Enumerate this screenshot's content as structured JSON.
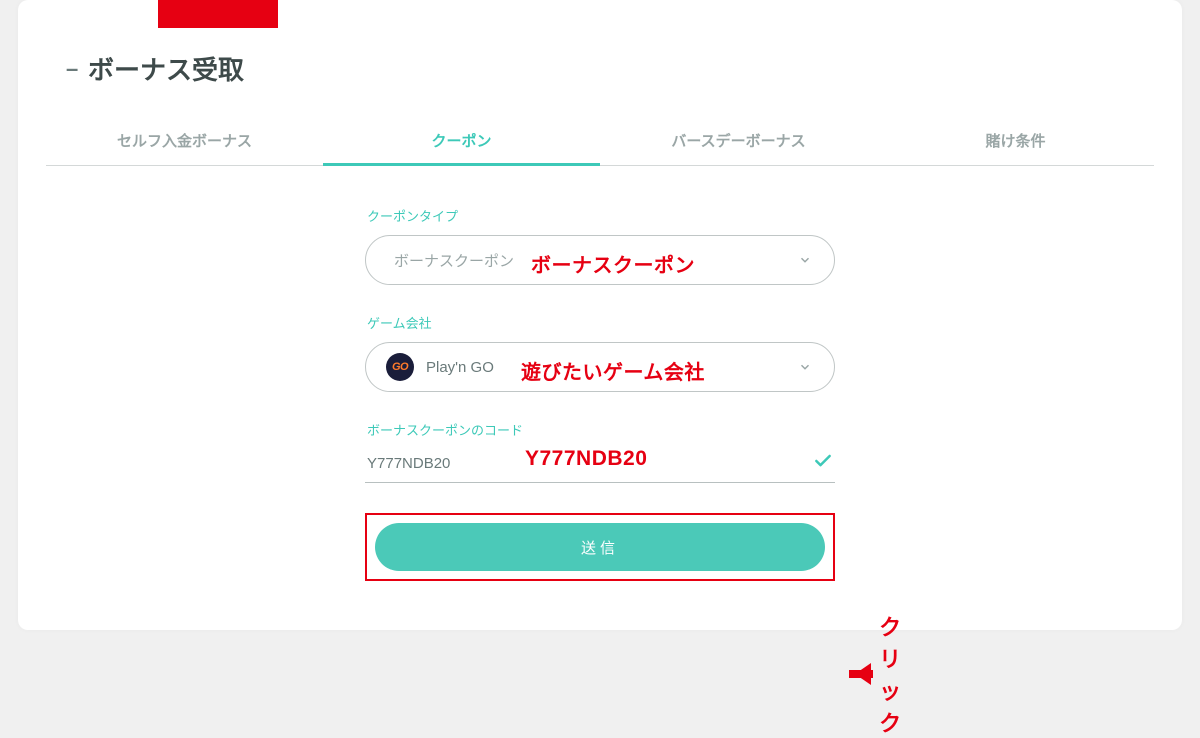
{
  "page_title": "ボーナス受取",
  "tabs": [
    {
      "label": "セルフ入金ボーナス",
      "active": false
    },
    {
      "label": "クーポン",
      "active": true
    },
    {
      "label": "バースデーボーナス",
      "active": false
    },
    {
      "label": "賭け条件",
      "active": false
    }
  ],
  "coupon_type": {
    "label": "クーポンタイプ",
    "selected": "ボーナスクーポン"
  },
  "provider": {
    "label": "ゲーム会社",
    "selected": "Play'n GO",
    "badge_text": "GO"
  },
  "code": {
    "label": "ボーナスクーポンのコード",
    "value": "Y777NDB20",
    "valid": true
  },
  "submit_label": "送信",
  "annotations": {
    "coupon_type_hint": "ボーナスクーポン",
    "provider_hint": "遊びたいゲーム会社",
    "code_hint": "Y777NDB20",
    "click_hint": "クリック"
  }
}
